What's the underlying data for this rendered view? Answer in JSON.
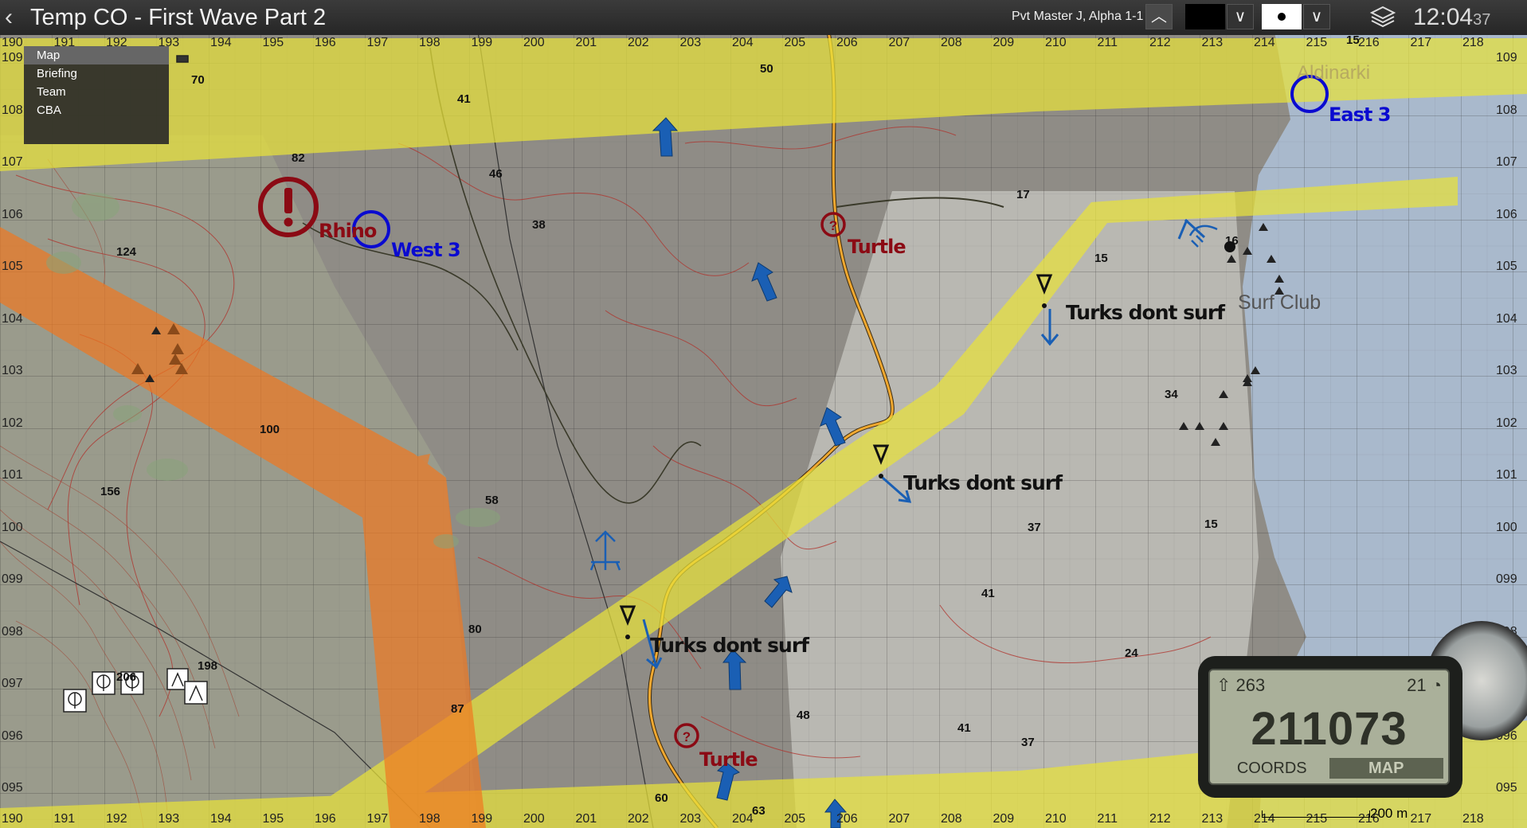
{
  "topbar": {
    "title": "Temp CO - First Wave Part 2",
    "player": "Pvt Master J, Alpha 1-1 1",
    "clock_time": "12:04",
    "clock_seconds": "37"
  },
  "menu": {
    "items": [
      "Map",
      "Briefing",
      "Team",
      "CBA"
    ]
  },
  "grid": {
    "x_labels": [
      "190",
      "191",
      "192",
      "193",
      "194",
      "195",
      "196",
      "197",
      "198",
      "199",
      "200",
      "201",
      "202",
      "203",
      "204",
      "205",
      "206",
      "207",
      "208",
      "209",
      "210",
      "211",
      "212",
      "213",
      "214",
      "215",
      "216",
      "217",
      "218"
    ],
    "y_labels": [
      "109",
      "108",
      "107",
      "106",
      "105",
      "104",
      "103",
      "102",
      "101",
      "100",
      "099",
      "098",
      "097",
      "096",
      "095"
    ]
  },
  "markers": {
    "rhino": "Rhino",
    "west3": "West 3",
    "east3": "East 3",
    "turtle1": "Turtle",
    "turtle2": "Turtle",
    "turks1": "Turks dont surf",
    "turks2": "Turks dont surf",
    "turks3": "Turks dont surf",
    "turks4": "Turks dont surf"
  },
  "places": {
    "surf_club": "Surf Club",
    "aldinarki": "Aldinarki"
  },
  "heights": [
    "70",
    "41",
    "50",
    "82",
    "46",
    "38",
    "17",
    "15",
    "124",
    "34",
    "100",
    "156",
    "58",
    "37",
    "15",
    "41",
    "80",
    "24",
    "198",
    "206",
    "87",
    "48",
    "41",
    "37",
    "60",
    "63",
    "15",
    "16"
  ],
  "gps": {
    "heading": "263",
    "speed": "21",
    "coords": "211073",
    "coords_label": "COORDS",
    "map_label": "MAP"
  },
  "scale": "200 m",
  "colors": {
    "zone_yellow": "#e8e23a",
    "zone_orange": "#f07820",
    "enemy_red": "#8b0a14",
    "friendly_blue": "#1a5fb4",
    "objective_blue": "#0a0ad0"
  }
}
